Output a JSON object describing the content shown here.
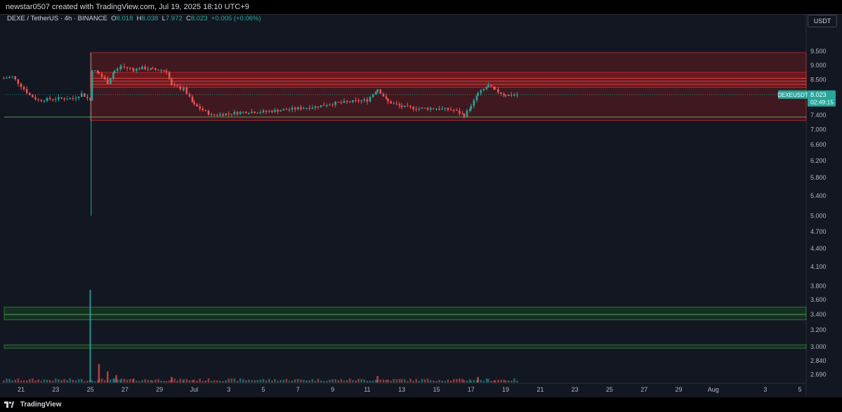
{
  "header": {
    "attribution": "newstar0507 created with TradingView.com, Jul 19, 2025 18:10 UTC+9"
  },
  "symbol": {
    "name": "DEXE / TetherUS · 4h · BINANCE",
    "open_label": "O",
    "open": "8.018",
    "high_label": "H",
    "high": "8.038",
    "low_label": "L",
    "low": "7.972",
    "close_label": "C",
    "close": "8.023",
    "change": "+0.005 (+0.06%)"
  },
  "currency_button": "USDT",
  "price_tag": {
    "ticker": "DEXEUSDT",
    "price": "8.023",
    "countdown": "02:49:15"
  },
  "footer": {
    "brand": "TradingView"
  },
  "colors": {
    "background": "#131722",
    "up": "#26a69a",
    "down": "#ef5350",
    "resistance_zone": "#b71c1c",
    "support_zone": "#1b5e20"
  },
  "chart_data": {
    "type": "candlestick",
    "scale": "log",
    "ylim": [
      2.6,
      10.4
    ],
    "price_axis_ticks": [
      "9.500",
      "9.000",
      "8.500",
      "8.000",
      "7.400",
      "7.000",
      "6.600",
      "6.200",
      "5.800",
      "5.400",
      "5.000",
      "4.700",
      "4.400",
      "4.100",
      "3.800",
      "3.600",
      "3.400",
      "3.200",
      "3.000",
      "2.840",
      "2.690"
    ],
    "price_axis_values": [
      9.5,
      9.0,
      8.5,
      8.0,
      7.4,
      7.0,
      6.6,
      6.2,
      5.8,
      5.4,
      5.0,
      4.7,
      4.4,
      4.1,
      3.8,
      3.6,
      3.4,
      3.2,
      3.0,
      2.84,
      2.69
    ],
    "time_axis_labels": [
      "21",
      "23",
      "25",
      "27",
      "29",
      "Jul",
      "3",
      "5",
      "7",
      "9",
      "11",
      "13",
      "15",
      "17",
      "19",
      "21",
      "23",
      "25",
      "27",
      "29",
      "Aug",
      "3",
      "5"
    ],
    "time_axis_days": [
      -10,
      -8,
      -6,
      -4,
      -2,
      0,
      2,
      4,
      6,
      8,
      10,
      12,
      14,
      16,
      18,
      20,
      22,
      24,
      26,
      28,
      30,
      33,
      35
    ],
    "last_price": 8.023,
    "zones": [
      {
        "kind": "resistance",
        "from": 7.25,
        "to": 9.45
      },
      {
        "kind": "resistance",
        "from": 8.25,
        "to": 8.75
      },
      {
        "kind": "support",
        "from": 3.33,
        "to": 3.5
      },
      {
        "kind": "support",
        "from": 2.98,
        "to": 3.02
      }
    ],
    "levels": [
      {
        "kind": "resistance",
        "value": 8.35
      },
      {
        "kind": "resistance",
        "value": 8.45
      },
      {
        "kind": "resistance",
        "value": 8.55
      },
      {
        "kind": "support",
        "value": 7.35
      },
      {
        "kind": "support",
        "value": 3.4
      }
    ],
    "price_path": [
      {
        "day": -11.0,
        "price": 8.55
      },
      {
        "day": -10.5,
        "price": 8.6
      },
      {
        "day": -9.5,
        "price": 8.0
      },
      {
        "day": -9.0,
        "price": 7.85
      },
      {
        "day": -8.0,
        "price": 7.9
      },
      {
        "day": -7.0,
        "price": 7.9
      },
      {
        "day": -6.5,
        "price": 8.05
      },
      {
        "day": -6.0,
        "price": 7.85
      },
      {
        "day": -5.9,
        "price": 8.85
      },
      {
        "day": -5.5,
        "price": 8.7
      },
      {
        "day": -5.0,
        "price": 8.4
      },
      {
        "day": -4.6,
        "price": 8.8
      },
      {
        "day": -4.2,
        "price": 8.95
      },
      {
        "day": -3.5,
        "price": 8.85
      },
      {
        "day": -3.0,
        "price": 8.9
      },
      {
        "day": -2.4,
        "price": 8.85
      },
      {
        "day": -1.6,
        "price": 8.8
      },
      {
        "day": -1.3,
        "price": 8.3
      },
      {
        "day": -0.6,
        "price": 8.2
      },
      {
        "day": 0.0,
        "price": 7.7
      },
      {
        "day": 0.5,
        "price": 7.55
      },
      {
        "day": 1.0,
        "price": 7.4
      },
      {
        "day": 2.0,
        "price": 7.45
      },
      {
        "day": 3.0,
        "price": 7.5
      },
      {
        "day": 4.0,
        "price": 7.5
      },
      {
        "day": 5.0,
        "price": 7.55
      },
      {
        "day": 6.0,
        "price": 7.6
      },
      {
        "day": 7.0,
        "price": 7.65
      },
      {
        "day": 8.0,
        "price": 7.75
      },
      {
        "day": 9.0,
        "price": 7.8
      },
      {
        "day": 10.0,
        "price": 7.85
      },
      {
        "day": 10.6,
        "price": 8.2
      },
      {
        "day": 11.2,
        "price": 7.8
      },
      {
        "day": 12.0,
        "price": 7.65
      },
      {
        "day": 13.0,
        "price": 7.6
      },
      {
        "day": 14.0,
        "price": 7.6
      },
      {
        "day": 15.0,
        "price": 7.55
      },
      {
        "day": 15.6,
        "price": 7.4
      },
      {
        "day": 16.0,
        "price": 7.65
      },
      {
        "day": 16.4,
        "price": 8.05
      },
      {
        "day": 17.0,
        "price": 8.3
      },
      {
        "day": 17.4,
        "price": 8.15
      },
      {
        "day": 18.0,
        "price": 8.0
      },
      {
        "day": 18.8,
        "price": 8.02
      }
    ],
    "volume": [
      {
        "day": -6.0,
        "volume": 1.0
      },
      {
        "day": -5.5,
        "volume": 0.2
      },
      {
        "day": -5.0,
        "volume": 0.12
      },
      {
        "day": -4.5,
        "volume": 0.08
      },
      {
        "day": 10.6,
        "volume": 0.07
      },
      {
        "day": 16.4,
        "volume": 0.06
      },
      {
        "day": -1.3,
        "volume": 0.06
      }
    ]
  }
}
